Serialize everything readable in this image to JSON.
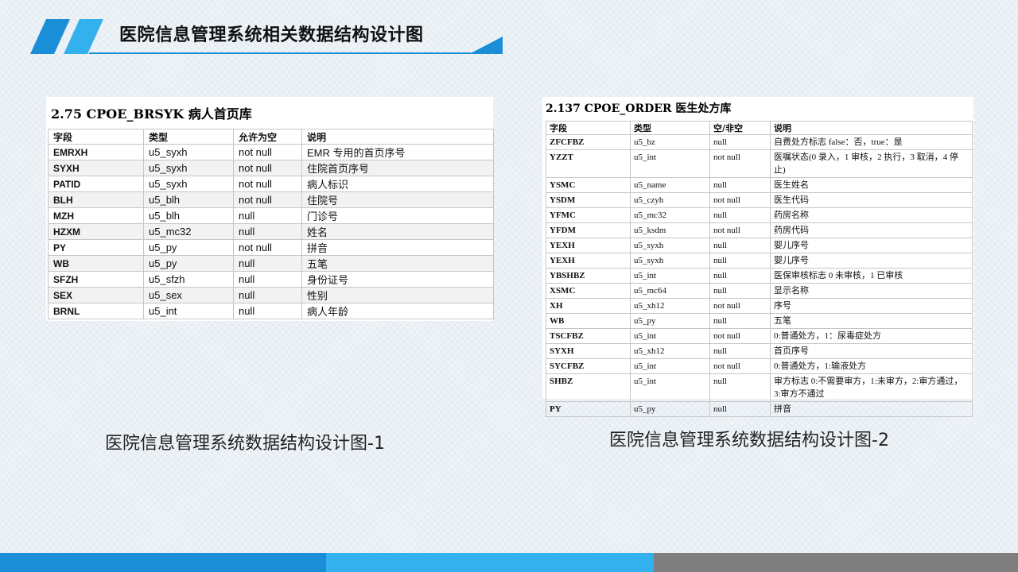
{
  "header": {
    "title": "医院信息管理系统相关数据结构设计图"
  },
  "colors": {
    "accent": "#1a8fd8",
    "accent_light": "#33b0ee",
    "gray_bar": "#7f7f7f"
  },
  "table1": {
    "title": "2.75   CPOE_BRSYK 病人首页库",
    "headers": [
      "字段",
      "类型",
      "允许为空",
      "说明"
    ],
    "rows": [
      [
        "EMRXH",
        "u5_syxh",
        "not null",
        "EMR 专用的首页序号"
      ],
      [
        "SYXH",
        "u5_syxh",
        "not null",
        "住院首页序号"
      ],
      [
        "PATID",
        "u5_syxh",
        "not null",
        "病人标识"
      ],
      [
        "BLH",
        "u5_blh",
        "not null",
        "住院号"
      ],
      [
        "MZH",
        "u5_blh",
        "null",
        "门诊号"
      ],
      [
        "HZXM",
        "u5_mc32",
        "null",
        "姓名"
      ],
      [
        "PY",
        "u5_py",
        "not null",
        "拼音"
      ],
      [
        "WB",
        "u5_py",
        "null",
        "五笔"
      ],
      [
        "SFZH",
        "u5_sfzh",
        "null",
        "身份证号"
      ],
      [
        "SEX",
        "u5_sex",
        "null",
        "性别"
      ],
      [
        "BRNL",
        "u5_int",
        "null",
        "病人年龄"
      ]
    ]
  },
  "table2": {
    "title": "2.137  CPOE_ORDER  医生处方库",
    "headers": [
      "字段",
      "类型",
      "空/非空",
      "说明"
    ],
    "rows": [
      [
        "ZFCFBZ",
        "u5_bz",
        "null",
        "自费处方标志  false：否，true：是"
      ],
      [
        "YZZT",
        "u5_int",
        "not null",
        "医嘱状态(0 录入，1 审核，2 执行，3 取消，4 停止)"
      ],
      [
        "YSMC",
        "u5_name",
        "null",
        "医生姓名"
      ],
      [
        "YSDM",
        "u5_czyh",
        "not null",
        "医生代码"
      ],
      [
        "YFMC",
        "u5_mc32",
        "null",
        "药房名称"
      ],
      [
        "YFDM",
        "u5_ksdm",
        "not null",
        "药房代码"
      ],
      [
        "YEXH",
        "u5_syxh",
        "null",
        "婴儿序号"
      ],
      [
        "YEXH",
        "u5_syxh",
        "null",
        "婴儿序号"
      ],
      [
        "YBSHBZ",
        "u5_int",
        "null",
        "医保审核标志  0 未审核，1 已审核"
      ],
      [
        "XSMC",
        "u5_mc64",
        "null",
        "显示名称"
      ],
      [
        "XH",
        "u5_xh12",
        "not null",
        "序号"
      ],
      [
        "WB",
        "u5_py",
        "null",
        "五笔"
      ],
      [
        "TSCFBZ",
        "u5_int",
        "not null",
        "0:普通处方，1：尿毒症处方"
      ],
      [
        "SYXH",
        "u5_xh12",
        "null",
        "首页序号"
      ],
      [
        "SYCFBZ",
        "u5_int",
        "not null",
        "0:普通处方，1:输液处方"
      ],
      [
        "SHBZ",
        "u5_int",
        "null",
        "审方标志 0:不需要审方，1:未审方，2:审方通过，3:审方不通过"
      ],
      [
        "PY",
        "u5_py",
        "null",
        "拼音"
      ]
    ]
  },
  "captions": {
    "left": "医院信息管理系统数据结构设计图-1",
    "right": "医院信息管理系统数据结构设计图-2"
  }
}
